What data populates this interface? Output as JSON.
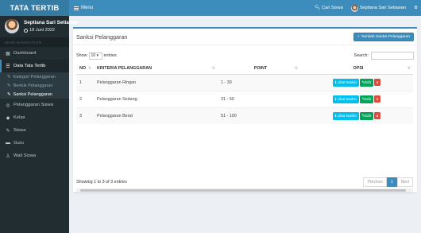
{
  "sidebar": {
    "brand": "TATA TERTIB",
    "user_name": "Septiana Sari Setiawan",
    "user_date": "18 Juni 2022",
    "nav_header": "MAIN NAVIGATION",
    "items": [
      {
        "label": "Dashboard",
        "icon": "dashboard-icon"
      },
      {
        "label": "Data Tata Tertib",
        "icon": "list-icon"
      }
    ],
    "subitems": [
      {
        "label": "Kategori Pelanggaran"
      },
      {
        "label": "Bentuk Pelanggaran"
      },
      {
        "label": "Sanksi Pelanggaran"
      }
    ],
    "items2": [
      {
        "label": "Pelanggaran Siswa",
        "icon": "circle-icon"
      },
      {
        "label": "Kelas",
        "icon": "tag-icon"
      },
      {
        "label": "Siswa",
        "icon": "user-icon"
      },
      {
        "label": "Guru",
        "icon": "id-card-icon"
      },
      {
        "label": "Wali Siswa",
        "icon": "person-icon"
      }
    ]
  },
  "topbar": {
    "menu_label": "Menu",
    "search_label": "Cari Siswa",
    "user_label": "Septiana Sari Setiawan"
  },
  "box": {
    "title": "Sanksi Pelanggaran",
    "add_button": "Tambah Sanksi Pelanggaran"
  },
  "controls": {
    "show_label": "Show",
    "entries_value": "10",
    "entries_label": "entries",
    "search_label": "Search:"
  },
  "table": {
    "headers": [
      "NO",
      "KRITERIA PELANGGARAN",
      "POINT",
      "OPSI"
    ],
    "rows": [
      {
        "no": "1",
        "kriteria": "Pelanggaran Ringan",
        "point": "1 - 30"
      },
      {
        "no": "2",
        "kriteria": "Pelanggaran Sedang",
        "point": "31 - 50"
      },
      {
        "no": "3",
        "kriteria": "Pelanggaran Berat",
        "point": "51 - 100"
      }
    ],
    "action_labels": {
      "info": "Lihat Sanksi",
      "edit": "Edit",
      "delete": "x"
    }
  },
  "footer": {
    "info": "Showing 1 to 3 of 3 entries",
    "previous": "Previous",
    "page": "1",
    "next": "Next"
  },
  "colors": {
    "header": "#3c8dbc",
    "sidebar": "#222d32",
    "info": "#00c0ef",
    "edit": "#00a65a",
    "delete": "#dd4b39"
  }
}
